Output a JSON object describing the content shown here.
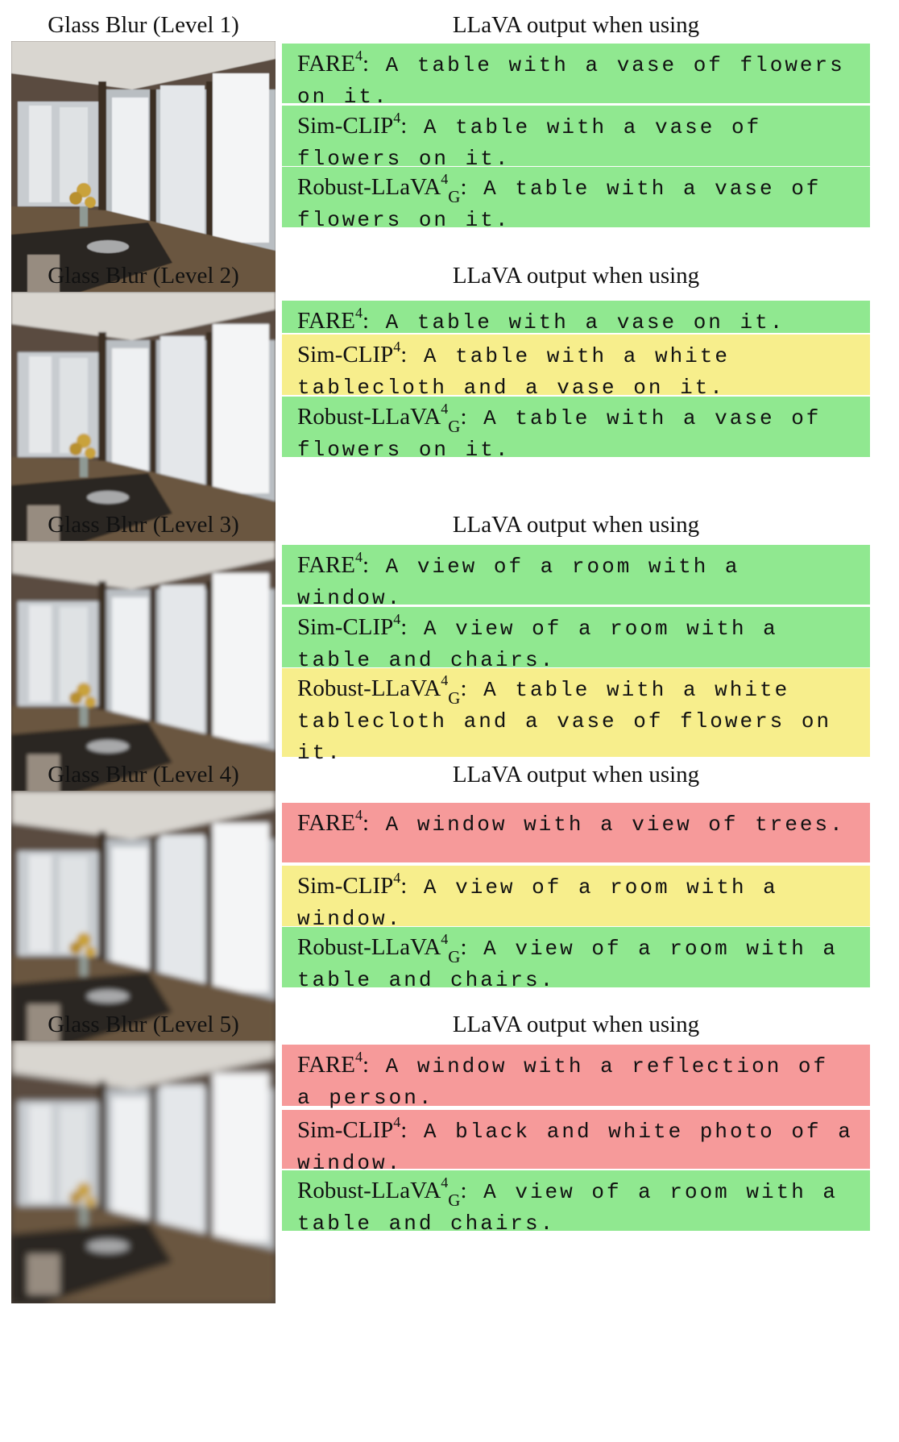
{
  "colors": {
    "green": "#90e890",
    "yellow": "#f7ee8c",
    "red": "#f69a9a"
  },
  "header_right": "LLaVA output when using",
  "sections": [
    {
      "title": "Glass Blur (Level 1)",
      "outputs": [
        {
          "model": "FARE",
          "sup": "4",
          "sub": "",
          "text": "A table with a vase of flowers on it.",
          "color": "green"
        },
        {
          "model": "Sim-CLIP",
          "sup": "4",
          "sub": "",
          "text": "A table with a vase of flowers on it.",
          "color": "green"
        },
        {
          "model": "Robust-LLaVA",
          "sup": "4",
          "sub": "G",
          "text": "A table with a vase of flowers on it.",
          "color": "green"
        }
      ]
    },
    {
      "title": "Glass Blur (Level 2)",
      "outputs": [
        {
          "model": "FARE",
          "sup": "4",
          "sub": "",
          "text": "A table with a vase on it.",
          "color": "green"
        },
        {
          "model": "Sim-CLIP",
          "sup": "4",
          "sub": "",
          "text": "A table with a white tablecloth and a vase on it.",
          "color": "yellow"
        },
        {
          "model": "Robust-LLaVA",
          "sup": "4",
          "sub": "G",
          "text": "A table with a vase of flowers on it.",
          "color": "green"
        }
      ]
    },
    {
      "title": "Glass Blur (Level 3)",
      "outputs": [
        {
          "model": "FARE",
          "sup": "4",
          "sub": "",
          "text": "A view of a room with a window.",
          "color": "green"
        },
        {
          "model": "Sim-CLIP",
          "sup": "4",
          "sub": "",
          "text": "A view of a room with a table and chairs.",
          "color": "green"
        },
        {
          "model": "Robust-LLaVA",
          "sup": "4",
          "sub": "G",
          "text": "A table with a white tablecloth and a vase of flowers on it.",
          "color": "yellow"
        }
      ]
    },
    {
      "title": "Glass Blur (Level 4)",
      "outputs": [
        {
          "model": "FARE",
          "sup": "4",
          "sub": "",
          "text": "A window with a view of trees.",
          "color": "red"
        },
        {
          "model": "Sim-CLIP",
          "sup": "4",
          "sub": "",
          "text": "A view of a room with a window.",
          "color": "yellow"
        },
        {
          "model": "Robust-LLaVA",
          "sup": "4",
          "sub": "G",
          "text": "A view of a room with a table and chairs.",
          "color": "green"
        }
      ]
    },
    {
      "title": "Glass Blur (Level 5)",
      "outputs": [
        {
          "model": "FARE",
          "sup": "4",
          "sub": "",
          "text": "A window with a reflection of a person.",
          "color": "red"
        },
        {
          "model": "Sim-CLIP",
          "sup": "4",
          "sub": "",
          "text": "A black and white photo of a window.",
          "color": "red"
        },
        {
          "model": "Robust-LLaVA",
          "sup": "4",
          "sub": "G",
          "text": "A view of a room with a table and chairs.",
          "color": "green"
        }
      ]
    }
  ]
}
